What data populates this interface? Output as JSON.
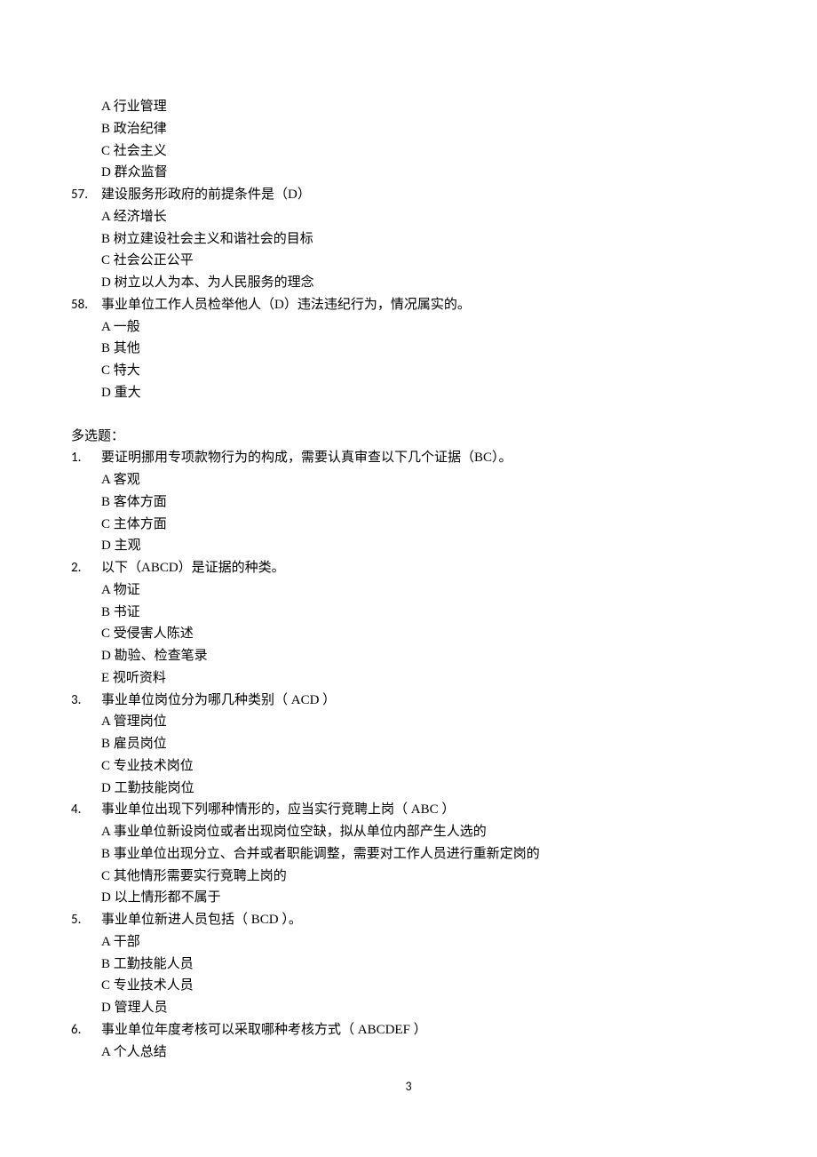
{
  "prev_options": {
    "a": "A 行业管理",
    "b": "B 政治纪律",
    "c": "C 社会主义",
    "d": "D 群众监督"
  },
  "q57": {
    "num": "57.",
    "text": "建设服务形政府的前提条件是（D）",
    "a": "A 经济增长",
    "b": "B 树立建设社会主义和谐社会的目标",
    "c": "C 社会公正公平",
    "d": "D 树立以人为本、为人民服务的理念"
  },
  "q58": {
    "num": "58.",
    "text": "事业单位工作人员检举他人（D）违法违纪行为，情况属实的。",
    "a": "A 一般",
    "b": "B 其他",
    "c": "C 特大",
    "d": "D 重大"
  },
  "section2": "多选题：",
  "mq1": {
    "num": "1.",
    "text": "要证明挪用专项款物行为的构成，需要认真审查以下几个证据（BC）。",
    "a": "A 客观",
    "b": "B 客体方面",
    "c": "C 主体方面",
    "d": "D 主观"
  },
  "mq2": {
    "num": "2.",
    "text": "以下（ABCD）是证据的种类。",
    "a": "A 物证",
    "b": "B 书证",
    "c": "C 受侵害人陈述",
    "d": "D 勘验、检查笔录",
    "e": "E 视听资料"
  },
  "mq3": {
    "num": "3.",
    "text": "事业单位岗位分为哪几种类别（ ACD ）",
    "a": "A 管理岗位",
    "b": "B 雇员岗位",
    "c": "C 专业技术岗位",
    "d": "D 工勤技能岗位"
  },
  "mq4": {
    "num": "4.",
    "text": "事业单位出现下列哪种情形的，应当实行竞聘上岗（ ABC ）",
    "a": "A 事业单位新设岗位或者出现岗位空缺，拟从单位内部产生人选的",
    "b": "B 事业单位出现分立、合并或者职能调整，需要对工作人员进行重新定岗的",
    "c": "C 其他情形需要实行竞聘上岗的",
    "d": "D 以上情形都不属于"
  },
  "mq5": {
    "num": "5.",
    "text": "事业单位新进人员包括（ BCD ）。",
    "a": "A 干部",
    "b": "B 工勤技能人员",
    "c": "C 专业技术人员",
    "d": "D 管理人员"
  },
  "mq6": {
    "num": "6.",
    "text": "事业单位年度考核可以采取哪种考核方式（ ABCDEF ）",
    "a": "A 个人总结"
  },
  "page_number": "3"
}
